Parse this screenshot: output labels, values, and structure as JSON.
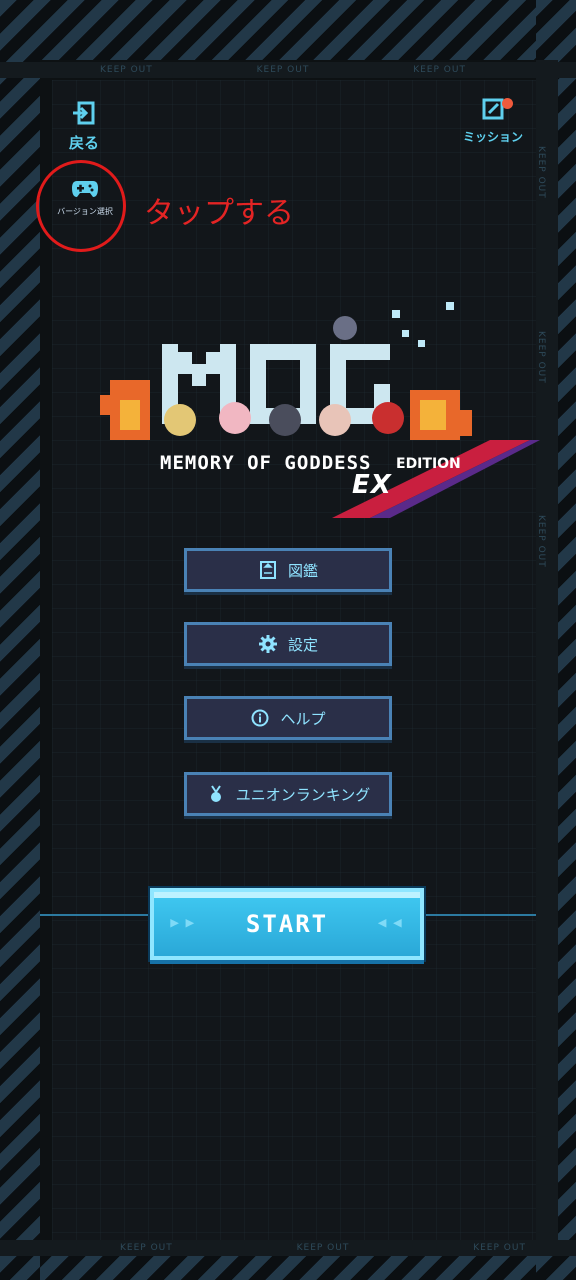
{
  "header": {
    "back_label": "戻る",
    "mission_label": "ミッション",
    "version_label": "バージョン選択"
  },
  "annotation": {
    "text": "タップする"
  },
  "tape": {
    "text": "KEEP OUT"
  },
  "logo": {
    "subtitle": "MEMORY OF GODDESS",
    "ex": "EX",
    "edition": "EDITION"
  },
  "menu": {
    "items": [
      {
        "label": "図鑑",
        "icon": "book-icon"
      },
      {
        "label": "設定",
        "icon": "gear-icon"
      },
      {
        "label": "ヘルプ",
        "icon": "info-icon"
      },
      {
        "label": "ユニオンランキング",
        "icon": "medal-icon"
      }
    ]
  },
  "start": {
    "label": "START"
  },
  "colors": {
    "accent": "#5fd0ee",
    "annotation": "#e11b1b",
    "start": "#3ec6ef"
  }
}
